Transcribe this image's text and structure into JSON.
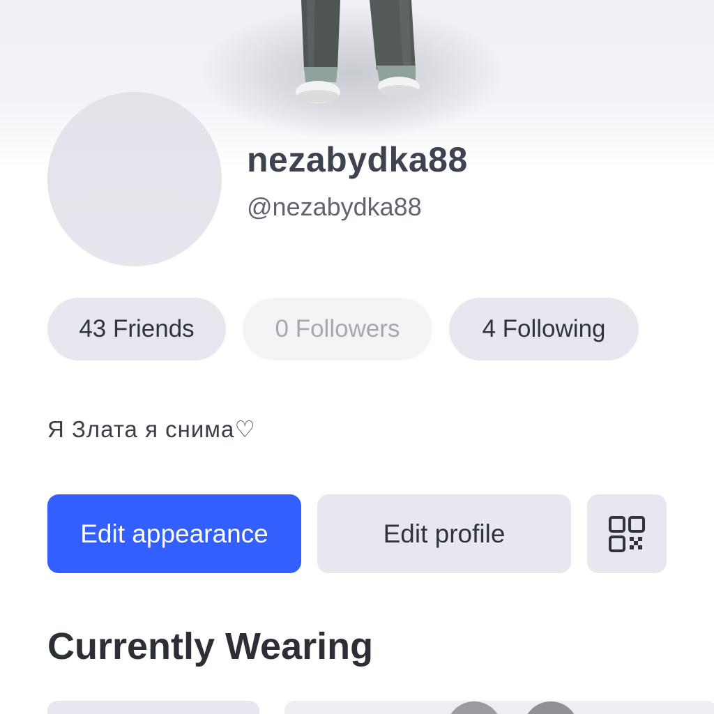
{
  "profile": {
    "display_name": "nezabydka88",
    "username": "@nezabydka88",
    "bio": "Я Злата я снима♡"
  },
  "social": {
    "friends": "43 Friends",
    "followers": "0 Followers",
    "following": "4 Following"
  },
  "actions": {
    "edit_appearance": "Edit appearance",
    "edit_profile": "Edit profile",
    "qr_icon": "qr-code-icon"
  },
  "sections": {
    "currently_wearing": "Currently Wearing"
  },
  "colors": {
    "primary_button": "#335fff",
    "pill_background": "#e6e7ef",
    "text_dark": "#2f333d"
  }
}
